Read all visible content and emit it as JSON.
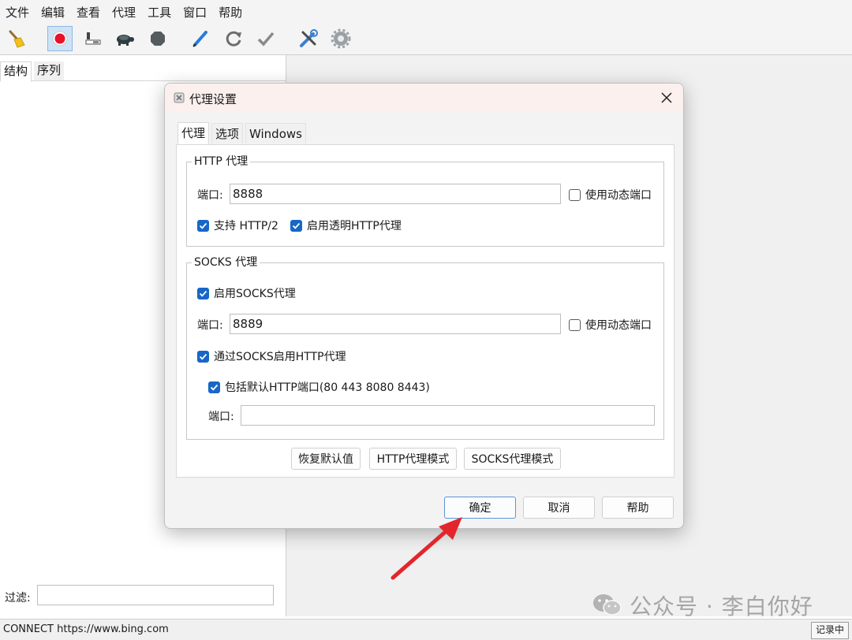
{
  "menubar": {
    "items": [
      "文件",
      "编辑",
      "查看",
      "代理",
      "工具",
      "窗口",
      "帮助"
    ]
  },
  "toolbar": {
    "buttons": [
      {
        "icon": "broom-icon"
      },
      {
        "icon": "record-icon",
        "active": true
      },
      {
        "icon": "throttle-icon"
      },
      {
        "icon": "turtle-icon"
      },
      {
        "icon": "stop-icon"
      },
      {
        "icon": "pen-icon"
      },
      {
        "icon": "refresh-icon"
      },
      {
        "icon": "check-icon"
      },
      {
        "icon": "tools-icon"
      },
      {
        "icon": "settings-gear-icon"
      }
    ]
  },
  "left_panel": {
    "tabs": [
      "结构",
      "序列"
    ],
    "filter_label": "过滤:",
    "filter_value": ""
  },
  "status": {
    "text": "CONNECT https://www.bing.com",
    "recording": "记录中"
  },
  "watermark": {
    "text": "公众号 · 李白你好"
  },
  "dialog": {
    "title": "代理设置",
    "tabs": [
      "代理",
      "选项",
      "Windows"
    ],
    "http_group": {
      "title": "HTTP 代理",
      "port_label": "端口:",
      "port_value": "8888",
      "dynamic_port": {
        "label": "使用动态端口",
        "checked": false
      },
      "http2": {
        "label": "支持 HTTP/2",
        "checked": true
      },
      "transparent": {
        "label": "启用透明HTTP代理",
        "checked": true
      }
    },
    "socks_group": {
      "title": "SOCKS 代理",
      "enable": {
        "label": "启用SOCKS代理",
        "checked": true
      },
      "port_label": "端口:",
      "port_value": "8889",
      "dynamic_port": {
        "label": "使用动态端口",
        "checked": false
      },
      "http_over_socks": {
        "label": "通过SOCKS启用HTTP代理",
        "checked": true
      },
      "include_default_ports": {
        "label": "包括默认HTTP端口(80 443 8080 8443)",
        "checked": true
      },
      "extra_port_label": "端口:",
      "extra_port_value": ""
    },
    "buttons": {
      "restore": "恢复默认值",
      "http_mode": "HTTP代理模式",
      "socks_mode": "SOCKS代理模式",
      "ok": "确定",
      "cancel": "取消",
      "help": "帮助"
    }
  },
  "colors": {
    "checkbox_accent": "#1767c7",
    "arrow": "#e3262b",
    "record": "#e8132b"
  }
}
